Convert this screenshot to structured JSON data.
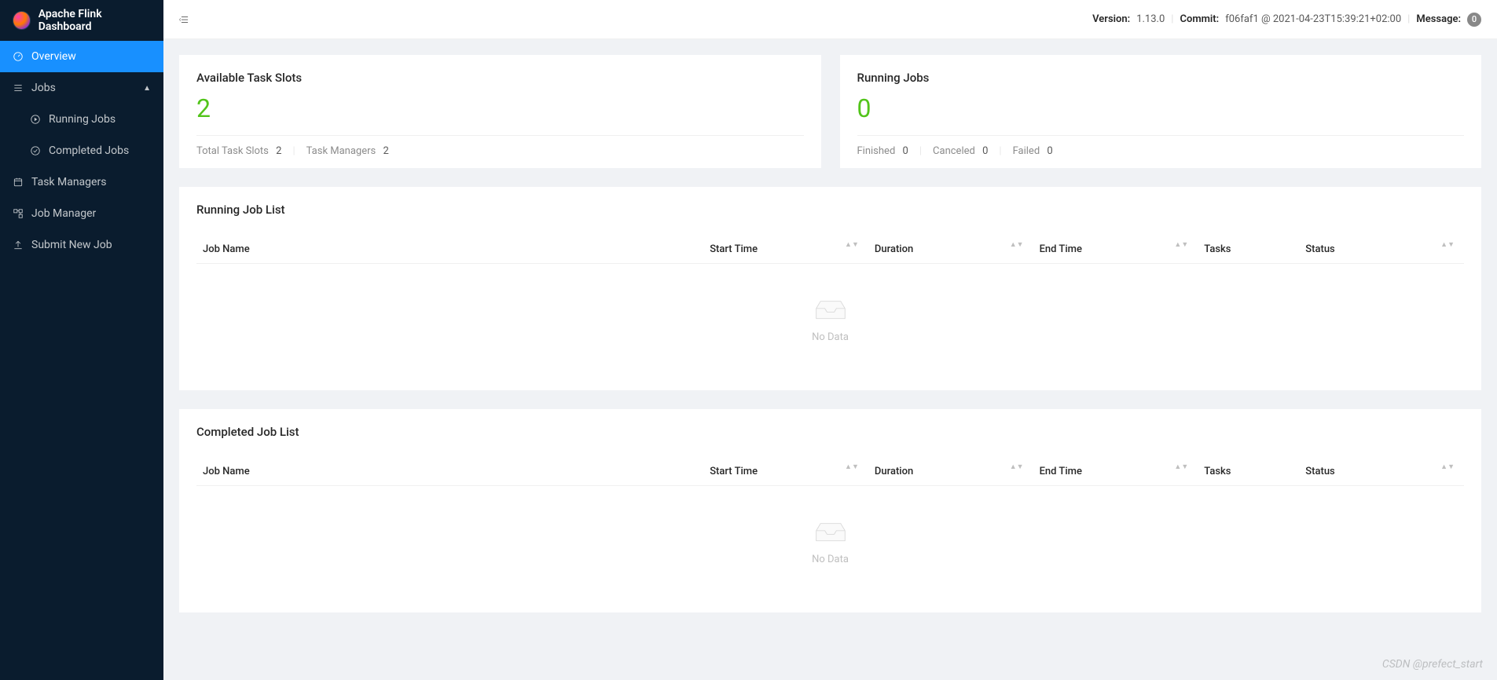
{
  "brand": "Apache Flink Dashboard",
  "sidebar": {
    "overview": "Overview",
    "jobs": "Jobs",
    "running_jobs": "Running Jobs",
    "completed_jobs": "Completed Jobs",
    "task_managers": "Task Managers",
    "job_manager": "Job Manager",
    "submit_new_job": "Submit New Job"
  },
  "topbar": {
    "version_label": "Version:",
    "version_value": "1.13.0",
    "commit_label": "Commit:",
    "commit_value": "f06faf1 @ 2021-04-23T15:39:21+02:00",
    "message_label": "Message:",
    "message_count": "0"
  },
  "stats": {
    "slots": {
      "title": "Available Task Slots",
      "value": "2",
      "total_label": "Total Task Slots",
      "total_value": "2",
      "tm_label": "Task Managers",
      "tm_value": "2"
    },
    "running": {
      "title": "Running Jobs",
      "value": "0",
      "finished_label": "Finished",
      "finished_value": "0",
      "canceled_label": "Canceled",
      "canceled_value": "0",
      "failed_label": "Failed",
      "failed_value": "0"
    }
  },
  "lists": {
    "running_title": "Running Job List",
    "completed_title": "Completed Job List",
    "columns": {
      "job_name": "Job Name",
      "start_time": "Start Time",
      "duration": "Duration",
      "end_time": "End Time",
      "tasks": "Tasks",
      "status": "Status"
    },
    "empty": "No Data"
  },
  "watermark": "CSDN @prefect_start"
}
